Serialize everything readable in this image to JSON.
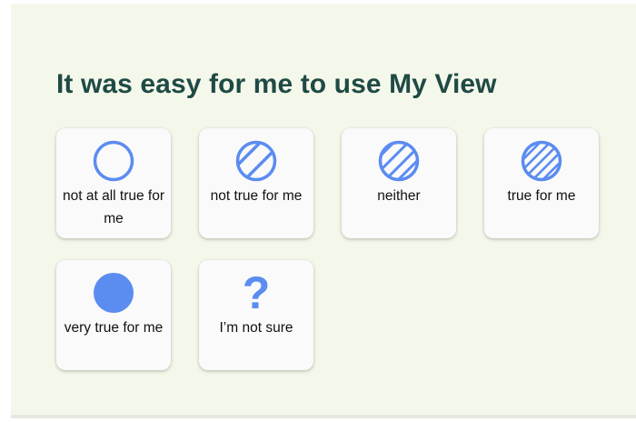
{
  "question": {
    "title": "It was easy for me to use My View"
  },
  "colors": {
    "background": "#f4f8ea",
    "title": "#1f4a45",
    "accent": "#5b8cf0",
    "card": "#fafafa"
  },
  "options": [
    {
      "label": "not at all true for me",
      "icon": "empty-circle-icon"
    },
    {
      "label": "not true for me",
      "icon": "sparse-hatched-circle-icon"
    },
    {
      "label": "neither",
      "icon": "hatched-circle-icon"
    },
    {
      "label": "true for me",
      "icon": "dense-hatched-circle-icon"
    },
    {
      "label": "very true for me",
      "icon": "filled-circle-icon"
    },
    {
      "label": "I’m not sure",
      "icon": "question-mark-icon",
      "glyph": "?"
    }
  ]
}
